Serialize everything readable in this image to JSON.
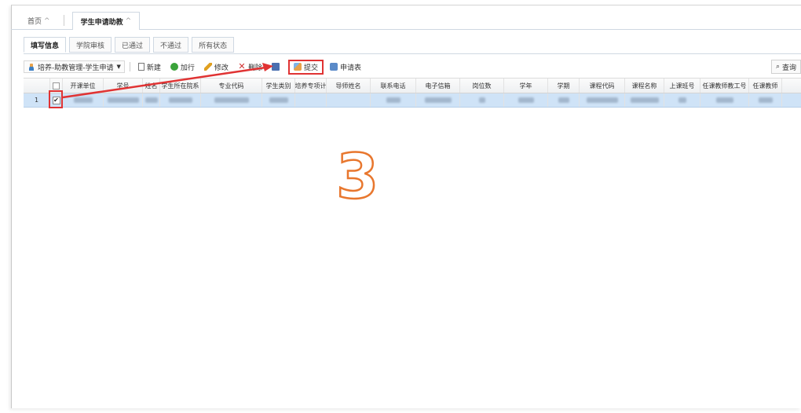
{
  "main_tabs": [
    {
      "label": "首页",
      "active": false
    },
    {
      "label": "学生申请助教",
      "active": true
    }
  ],
  "sub_tabs": [
    {
      "label": "填写信息",
      "active": true
    },
    {
      "label": "学院审核",
      "active": false
    },
    {
      "label": "已通过",
      "active": false
    },
    {
      "label": "不通过",
      "active": false
    },
    {
      "label": "所有状态",
      "active": false
    }
  ],
  "toolbar": {
    "module_dropdown": "培养-助教管理-学生申请",
    "new_label": "新建",
    "add_label": "加行",
    "edit_label": "修改",
    "delete_label": "删除",
    "submit_label": "提交",
    "form_label": "申请表",
    "search_label": "查询"
  },
  "grid": {
    "columns": [
      "开课单位",
      "学号",
      "姓名",
      "学生所在院系",
      "专业代码",
      "学生类别",
      "培养专项计",
      "导师姓名",
      "联系电话",
      "电子信箱",
      "岗位数",
      "学年",
      "学期",
      "课程代码",
      "课程名称",
      "上课班号",
      "任课教师教工号",
      "任课教师"
    ],
    "rows": [
      {
        "row_num": "1",
        "checked": true
      }
    ]
  },
  "annotation": {
    "step_number": "3"
  },
  "colors": {
    "highlight_red": "#e03333",
    "selected_row": "#cfe3f7",
    "annotation_orange": "#e8772e"
  }
}
